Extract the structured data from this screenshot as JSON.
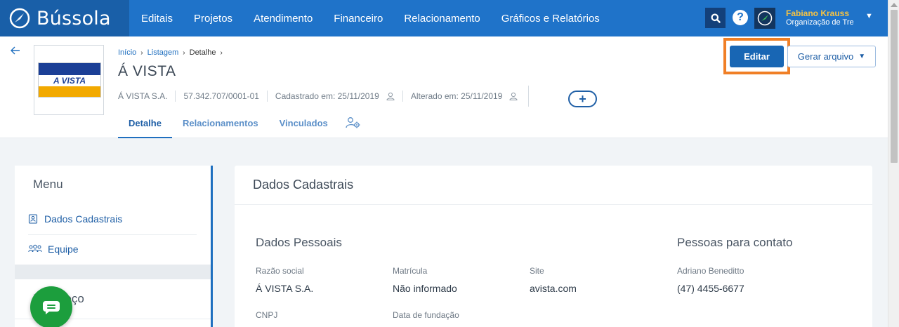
{
  "app": {
    "name": "Bússola"
  },
  "nav": [
    "Editais",
    "Projetos",
    "Atendimento",
    "Financeiro",
    "Relacionamento",
    "Gráficos e Relatórios"
  ],
  "user": {
    "name": "Fabiano Krauss",
    "org": "Organização de Treinamento"
  },
  "icons": {
    "search": "search-icon",
    "help": "help-icon",
    "back": "back-arrow-icon",
    "chevron": "chevron-down-icon",
    "person": "person-icon",
    "team_settings": "team-settings-icon",
    "chat": "chat-icon",
    "id_card": "id-card-icon",
    "team": "team-icon"
  },
  "colors": {
    "navbar": "#1f73c9",
    "brand_bg": "#195fa8",
    "primary": "#1866b4",
    "highlight": "#f07f26",
    "chat": "#1c9e3d"
  },
  "breadcrumb": {
    "home": "Início",
    "list": "Listagem",
    "current": "Detalhe",
    "sep": "›"
  },
  "entity": {
    "title": "Á VISTA",
    "logo_text": "A VISTA",
    "name": "Á VISTA S.A.",
    "cnpj": "57.342.707/0001-01",
    "created": "Cadastrado em: 25/11/2019",
    "changed": "Alterado em: 25/11/2019"
  },
  "actions": {
    "add": "+",
    "edit": "Editar",
    "generate": "Gerar arquivo"
  },
  "tabs": {
    "detail": "Detalhe",
    "relations": "Relacionamentos",
    "linked": "Vinculados"
  },
  "sidebar": {
    "title": "Menu",
    "items": [
      "Dados Cadastrais",
      "Equipe"
    ],
    "next_section_title": "Endereço"
  },
  "main": {
    "title": "Dados Cadastrais",
    "personal": {
      "title": "Dados Pessoais",
      "razao_label": "Razão social",
      "razao_value": "Á VISTA S.A.",
      "matricula_label": "Matrícula",
      "matricula_value": "Não informado",
      "site_label": "Site",
      "site_value": "avista.com",
      "cnpj_label": "CNPJ",
      "fundacao_label": "Data de fundação"
    },
    "contacts": {
      "title": "Pessoas para contato",
      "name": "Adriano Beneditto",
      "phone": "(47) 4455-6677"
    }
  }
}
